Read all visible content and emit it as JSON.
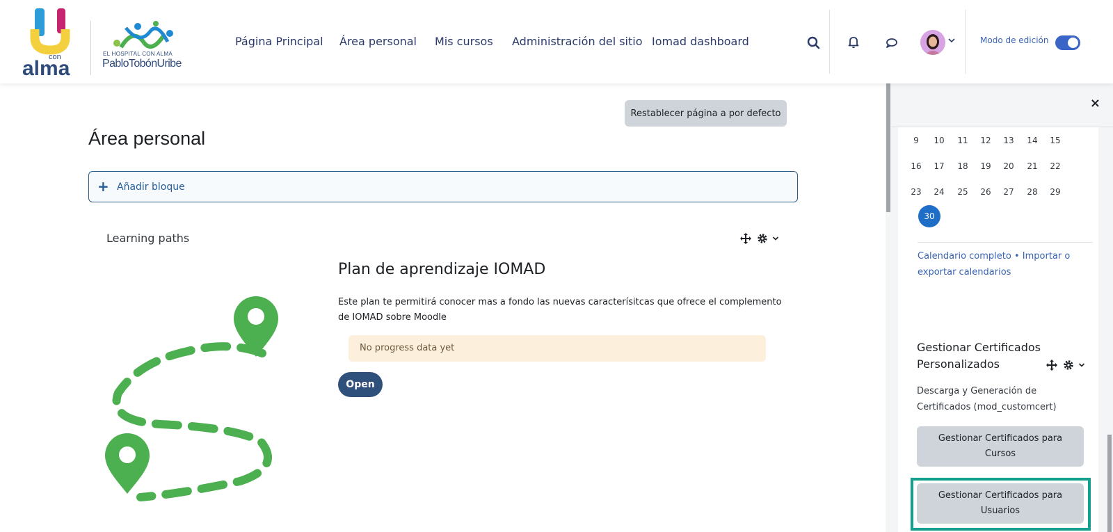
{
  "header": {
    "brand": {
      "u_logo_text": "con alma",
      "hospital_tagline": "EL HOSPITAL CON ALMA",
      "hospital_name": "PabloTobónUribe"
    },
    "nav": [
      {
        "label": "Página Principal"
      },
      {
        "label": "Área personal"
      },
      {
        "label": "Mis cursos"
      },
      {
        "label": "Administración del sitio"
      },
      {
        "label": "Iomad dashboard"
      }
    ],
    "icons": [
      "search-icon",
      "bell-icon",
      "message-icon",
      "user-avatar",
      "chevron-down-icon"
    ],
    "edit_mode_label": "Modo de edición",
    "edit_mode_on": true,
    "colors": {
      "accent": "#3a64c6",
      "nav_text": "#2b3a67"
    }
  },
  "main": {
    "reset_button": "Restablecer página a por defecto",
    "title": "Área personal",
    "add_block": "Añadir bloque",
    "learning_paths": {
      "block_title": "Learning paths",
      "plan_title": "Plan de aprendizaje IOMAD",
      "plan_description": "Este plan te permitirá conocer mas a fondo las nuevas caracterísitcas que ofrece el complemento de IOMAD sobre Moodle",
      "progress_text": "No progress data yet",
      "open_button": "Open",
      "illustration_color": "#4caf50"
    }
  },
  "drawer": {
    "close_icon": "×",
    "calendar": {
      "rows": [
        [
          "9",
          "10",
          "11",
          "12",
          "13",
          "14",
          "15"
        ],
        [
          "16",
          "17",
          "18",
          "19",
          "20",
          "21",
          "22"
        ],
        [
          "23",
          "24",
          "25",
          "26",
          "27",
          "28",
          "29"
        ]
      ],
      "today": "30",
      "links_full": "Calendario completo",
      "links_sep": " • ",
      "links_export": "Importar o exportar calendarios"
    },
    "certificates": {
      "title": "Gestionar Certificados Personalizados",
      "description": "Descarga y Generación de Certificados (mod_customcert)",
      "btn_courses": "Gestionar Certificados para Cursos",
      "btn_users": "Gestionar Certificados para Usuarios",
      "highlight_color": "#12a08e"
    }
  }
}
